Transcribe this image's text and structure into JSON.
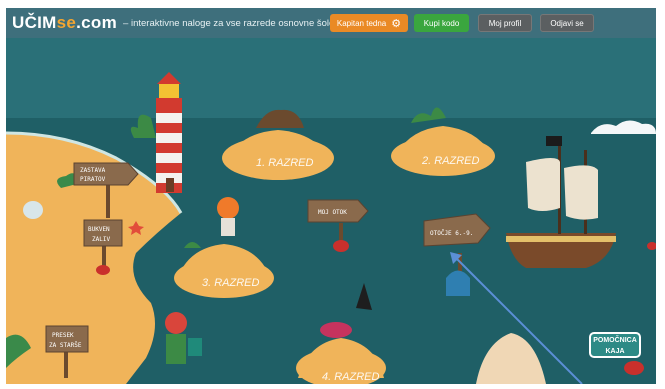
{
  "header": {
    "logo_main": "UČIM",
    "logo_accent": "se",
    "logo_tail": ".com",
    "dash": "–",
    "tagline": "interaktivne naloge za vse razrede osnovne šole",
    "buttons": {
      "kapitan": "Kapitan tedna",
      "kupi": "Kupi kodo",
      "profil": "Moj profil",
      "odjavi": "Odjavi se"
    }
  },
  "map": {
    "islands": [
      "1. RAZRED",
      "2. RAZRED",
      "3. RAZRED",
      "4. RAZRED"
    ],
    "signs": {
      "zastava": [
        "ZASTAVA",
        "PIRATOV"
      ],
      "bukev": [
        "BUKVEN",
        "ZALIV"
      ],
      "presek": [
        "PRESEK",
        "ZA STARŠE"
      ],
      "moj_otok": "MOJ OTOK",
      "otocje": "OTOČJE 6.-9."
    },
    "help_button": [
      "POMOČNICA",
      "KAJA"
    ]
  },
  "colors": {
    "header_bg": "#3e6f7c",
    "sea": "#1f5f66",
    "sand": "#f0b45a",
    "accent_orange": "#ea8a25",
    "accent_green": "#3aa63e",
    "arrow": "#5b8fd6"
  }
}
